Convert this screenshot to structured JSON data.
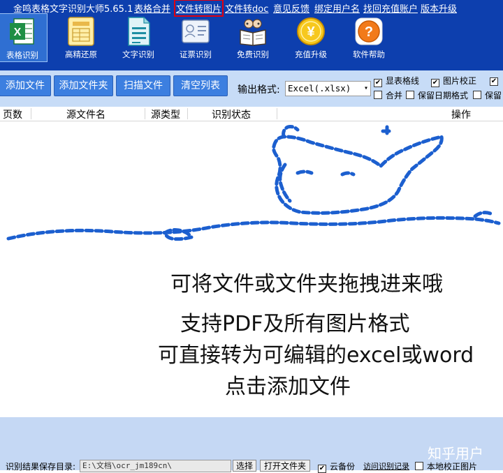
{
  "app": {
    "title": "金鸣表格文字识别大师5.65.1"
  },
  "menu": [
    {
      "label": "表格合并"
    },
    {
      "label": "文件转图片"
    },
    {
      "label": "文件转doc"
    },
    {
      "label": "意见反馈"
    },
    {
      "label": "绑定用户名"
    },
    {
      "label": "找回充值账户"
    },
    {
      "label": "版本升级"
    }
  ],
  "toolbar": [
    {
      "label": "表格识别",
      "icon": "excel-icon"
    },
    {
      "label": "高精还原",
      "icon": "document-grid-icon"
    },
    {
      "label": "文字识别",
      "icon": "text-document-icon"
    },
    {
      "label": "证票识别",
      "icon": "id-card-icon"
    },
    {
      "label": "免费识别",
      "icon": "open-book-icon"
    },
    {
      "label": "充值升级",
      "icon": "yuan-coin-icon"
    },
    {
      "label": "软件帮助",
      "icon": "help-icon"
    }
  ],
  "actions": {
    "add_file": "添加文件",
    "add_folder": "添加文件夹",
    "scan_file": "扫描文件",
    "clear_list": "清空列表"
  },
  "output": {
    "label": "输出格式:",
    "selected": "Excel(.xlsx)"
  },
  "options": [
    {
      "label": "显表格线",
      "checked": "✔"
    },
    {
      "label": "图片校正",
      "checked": "✔"
    },
    {
      "label": "",
      "checked": "✔"
    },
    {
      "label": "合并",
      "checked": ""
    },
    {
      "label": "保留日期格式",
      "checked": ""
    },
    {
      "label": "保留",
      "checked": ""
    }
  ],
  "table": {
    "columns": [
      "页数",
      "源文件名",
      "源类型",
      "识别状态",
      "操作"
    ]
  },
  "dropzone": {
    "lines": [
      "可将文件或文件夹拖拽进来哦",
      "支持PDF及所有图片格式",
      "可直接转为可编辑的excel或word",
      "点击添加文件"
    ]
  },
  "bottom": {
    "watermark": "知乎用户",
    "save_dir_label": "识别结果保存目录:",
    "save_dir_value": "E:\\文档\\ocr_jm189cn\\",
    "choose": "选择",
    "open_folder": "打开文件夹",
    "cloud_backup": "云备份",
    "cloud_backup_checked": "✔",
    "visit_records": "访问识别记录",
    "local_correct": "本地校正图片",
    "local_correct_checked": ""
  },
  "colors": {
    "topbar": "#0d3fae",
    "control_bar": "#c7dcf7",
    "button": "#3c7fe0",
    "highlight_box": "#e00010",
    "doodle": "#1c5fcf"
  }
}
